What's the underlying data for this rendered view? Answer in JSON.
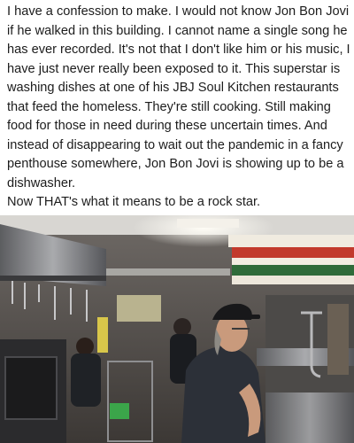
{
  "post": {
    "paragraph": "I have a confession to make. I would not know Jon Bon Jovi if he walked in this building. I cannot name a single song he has ever recorded. It's not that I don't like him or his music, I have just never really been exposed to it. This superstar is washing dishes at one of his JBJ Soul Kitchen restaurants that feed the homeless. They're still cooking. Still making food for those in need during these uncertain times. And instead of disappearing to wait out the pandemic in a fancy penthouse somewhere, Jon Bon Jovi is showing up to be a dishwasher.",
    "closing": "Now THAT's what it means to be a rock star."
  },
  "photo": {
    "subject": "kitchen-dishwashing-scene",
    "colors": {
      "wall": "#8a8580",
      "steel": "#9a9a9c",
      "shirt_dark": "#2c3038",
      "skin": "#c99a7c",
      "cap": "#18181a",
      "pan_red": "#c23a2c",
      "pan_green": "#2f6b3a",
      "light": "#f4f1ea"
    }
  }
}
